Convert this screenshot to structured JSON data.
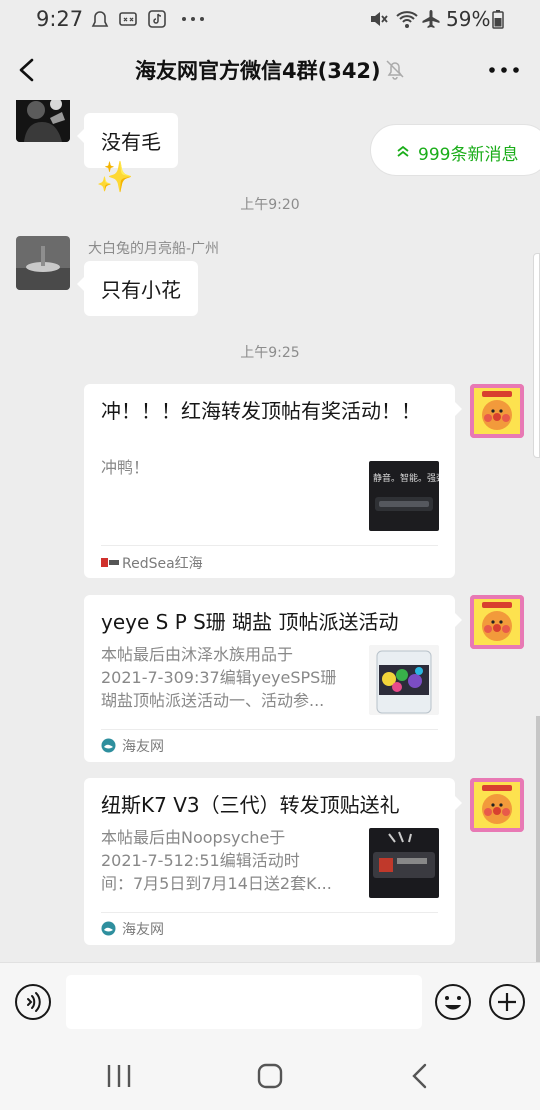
{
  "status_bar": {
    "time": "9:27",
    "battery_percent": "59%",
    "icons": [
      "notification-icon",
      "voicemail-icon",
      "tiktok-icon",
      "more-dots-icon",
      "mute-icon",
      "wifi-icon",
      "airplane-icon",
      "battery-icon"
    ]
  },
  "header": {
    "title": "海友网官方微信4群(342)",
    "back_icon": "chevron-left-icon",
    "mute_icon": "bell-off-icon",
    "more_icon": "more-horizontal-icon"
  },
  "new_messages": {
    "label": "999条新消息",
    "icon": "double-chevron-up-icon"
  },
  "messages": [
    {
      "type": "text",
      "sender": "",
      "text": "没有毛",
      "reaction": "✨"
    },
    {
      "type": "time",
      "text": "上午9:20"
    },
    {
      "type": "text",
      "sender": "大白兔的月亮船-广州",
      "text": "只有小花"
    },
    {
      "type": "time",
      "text": "上午9:25"
    },
    {
      "type": "card",
      "side": "right",
      "title": "冲！！！红海转发顶帖有奖活动！！",
      "desc": "冲鸭！",
      "thumb_caption": "静音。智能。强劲",
      "source": "RedSea红海"
    },
    {
      "type": "card",
      "side": "right",
      "title": "yeye S P S珊 瑚盐 顶帖派送活动",
      "desc_lines": [
        "本帖最后由沐泽水族用品于",
        "2021-7-309:37编辑yeyeSPS珊",
        "瑚盐顶帖派送活动一、活动参..."
      ],
      "source": "海友网"
    },
    {
      "type": "card",
      "side": "right",
      "title": "纽斯K7 V3（三代）转发顶贴送礼",
      "desc_lines": [
        "本帖最后由Noopsyche于",
        "2021-7-512:51编辑活动时",
        "间：7月5日到7月14日送2套K..."
      ],
      "source": "海友网"
    }
  ],
  "input_bar": {
    "voice_icon": "voice-icon",
    "emoji_icon": "emoji-icon",
    "plus_icon": "plus-circle-icon",
    "value": ""
  },
  "nav_bar": {
    "icons": [
      "recent-apps-icon",
      "home-icon",
      "back-icon"
    ]
  },
  "colors": {
    "background": "#ededed",
    "accent": "#1aad19",
    "bubble": "#ffffff",
    "anpanman_bg": "#e879b4"
  }
}
